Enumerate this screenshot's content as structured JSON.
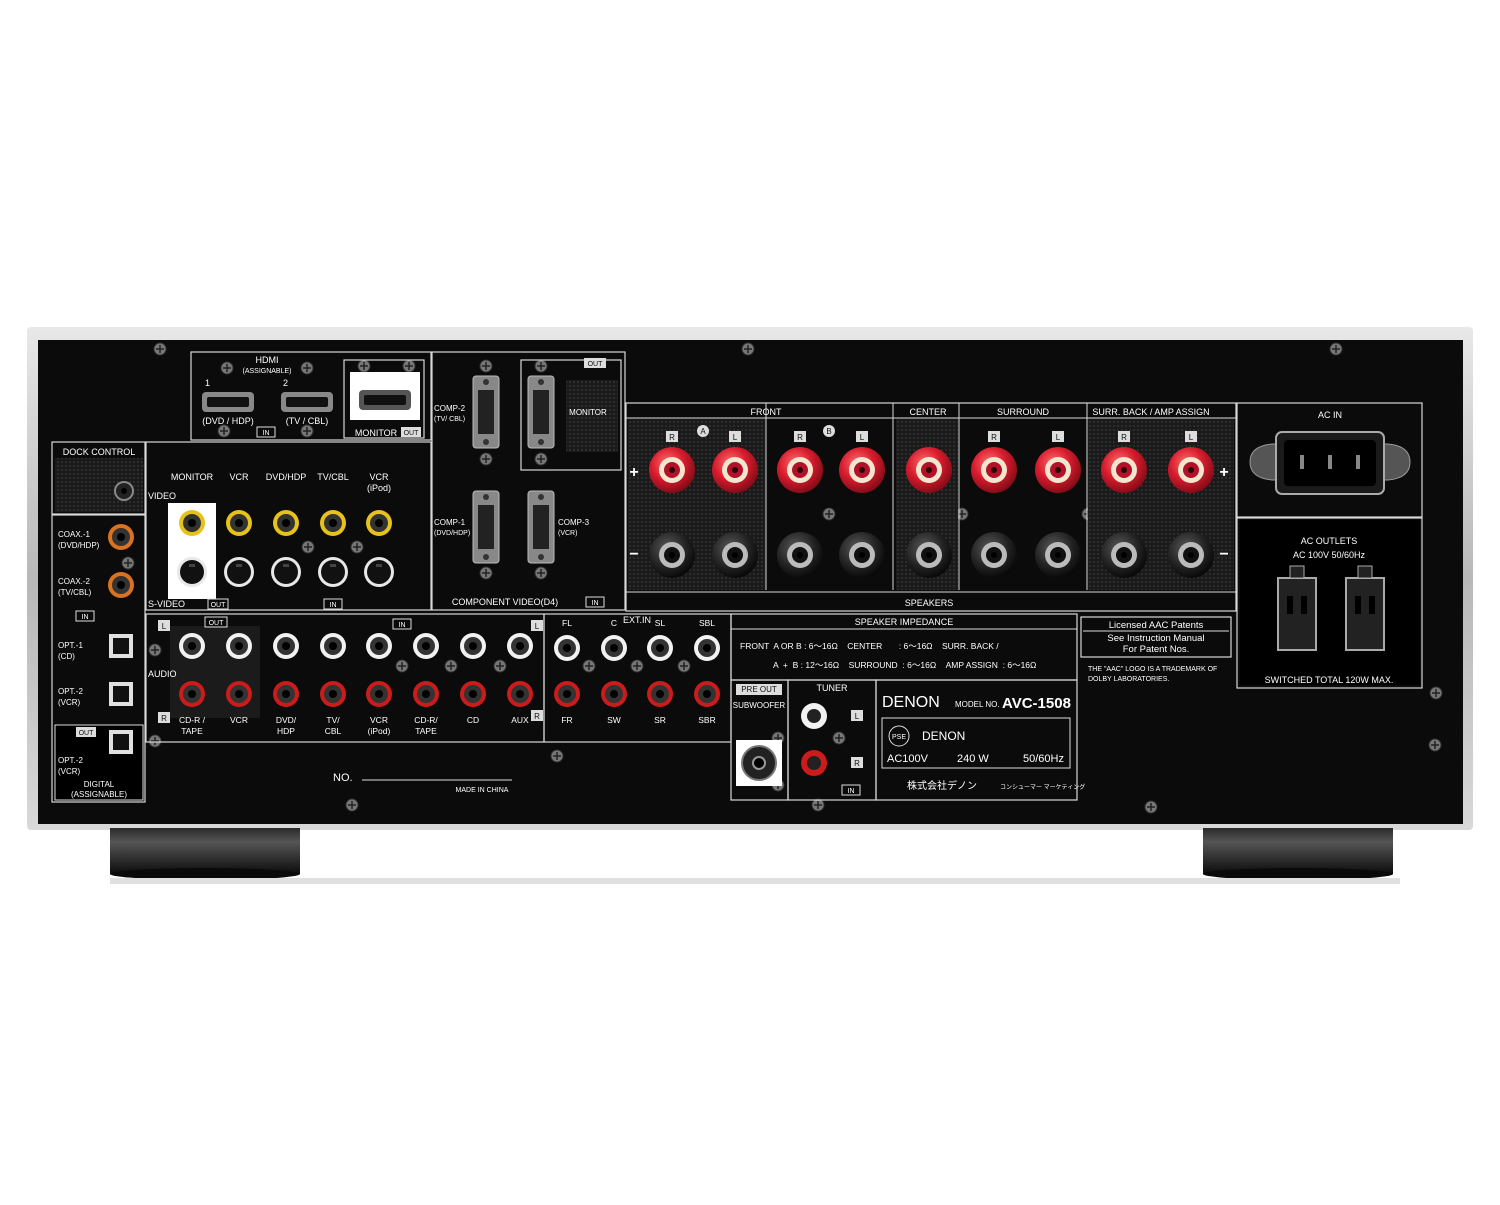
{
  "device": {
    "brand": "DENON",
    "model_label": "MODEL NO.",
    "model": "AVC-1508",
    "power": {
      "voltage": "AC100V",
      "watts": "240 W",
      "freq": "50/60Hz"
    },
    "maker_jp": "株式会社デノン",
    "maker_jp_small": "コンシューマー マーケティング",
    "pse": "PSE",
    "serial_label": "NO.",
    "made_in": "MADE IN CHINA"
  },
  "hdmi": {
    "title": "HDMI",
    "subtitle": "(ASSIGNABLE)",
    "in1_num": "1",
    "in1_label": "(DVD / HDP)",
    "in2_num": "2",
    "in2_label": "(TV / CBL)",
    "in_tag": "IN",
    "monitor_label": "MONITOR",
    "out_tag": "OUT"
  },
  "component": {
    "comp2": "COMP-2",
    "comp2_sub": "(TV/ CBL)",
    "comp1": "COMP-1",
    "comp1_sub": "(DVD/HDP)",
    "comp3": "COMP-3",
    "comp3_sub": "(VCR)",
    "monitor": "MONITOR",
    "out_tag": "OUT",
    "footer": "COMPONENT VIDEO(D4)",
    "in_tag": "IN"
  },
  "dock": {
    "label": "DOCK CONTROL"
  },
  "video": {
    "video_label": "VIDEO",
    "svideo_label": "S-VIDEO",
    "out_tag": "OUT",
    "in_tag": "IN",
    "cols": [
      "MONITOR",
      "VCR",
      "DVD/HDP",
      "TV/CBL",
      "VCR"
    ],
    "vcr_sub": "(iPod)"
  },
  "digital": {
    "coax1": "COAX.-1",
    "coax1_sub": "(DVD/HDP)",
    "coax2": "COAX.-2",
    "coax2_sub": "(TV/CBL)",
    "in_tag": "IN",
    "opt1": "OPT.-1",
    "opt1_sub": "(CD)",
    "opt2": "OPT.-2",
    "opt2_sub": "(VCR)",
    "out_tag": "OUT",
    "opt_out": "OPT.-2",
    "opt_out_sub": "(VCR)",
    "footer1": "DIGITAL",
    "footer2": "(ASSIGNABLE)"
  },
  "audio": {
    "label": "AUDIO",
    "l": "L",
    "r": "R",
    "out_tag": "OUT",
    "in_tag": "IN",
    "labels": [
      {
        "a": "CD-R /",
        "b": "TAPE"
      },
      {
        "a": "VCR",
        "b": ""
      },
      {
        "a": "DVD/",
        "b": "HDP"
      },
      {
        "a": "TV/",
        "b": "CBL"
      },
      {
        "a": "VCR",
        "b": "(iPod)"
      },
      {
        "a": "CD-R/",
        "b": "TAPE"
      },
      {
        "a": "CD",
        "b": ""
      },
      {
        "a": "AUX",
        "b": ""
      }
    ]
  },
  "ext_in": {
    "label": "EXT.IN",
    "top": [
      "FL",
      "C",
      "SL",
      "SBL"
    ],
    "bottom": [
      "FR",
      "SW",
      "SR",
      "SBR"
    ]
  },
  "preout": {
    "tag": "PRE OUT",
    "label": "SUBWOOFER"
  },
  "tuner": {
    "label": "TUNER",
    "l": "L",
    "r": "R",
    "in_tag": "IN"
  },
  "speakers": {
    "front": "FRONT",
    "a": "A",
    "b": "B",
    "center": "CENTER",
    "surround": "SURROUND",
    "surr_back": "SURR. BACK / AMP ASSIGN",
    "r": "R",
    "l": "L",
    "footer": "SPEAKERS",
    "plus": "+",
    "minus": "−"
  },
  "impedance": {
    "title": "SPEAKER IMPEDANCE",
    "row1": "FRONT  A OR B : 6～16Ω    CENTER       : 6～16Ω    SURR. BACK /",
    "row2": "A  +  B : 12～16Ω    SURROUND  : 6～16Ω    AMP ASSIGN  : 6～16Ω"
  },
  "aac": {
    "line1": "Licensed AAC Patents",
    "line2": "See Instruction Manual",
    "line3": "For Patent Nos.",
    "note1": "THE \"AAC\" LOGO IS A TRADEMARK OF",
    "note2": "DOLBY LABORATORIES."
  },
  "ac_in": {
    "label": "AC IN"
  },
  "ac_outlets": {
    "title": "AC OUTLETS",
    "spec": "AC 100V   50/60Hz",
    "footer": "SWITCHED TOTAL 120W  MAX."
  },
  "colors": {
    "panel": "#0b0b0b",
    "chassis": "#c9c9c9",
    "binding_red": "#c8102e",
    "rca_yellow": "#e6c21a",
    "rca_red": "#cc1b1b",
    "rca_white": "#f2f2f2",
    "coax_orange": "#d9731f"
  }
}
